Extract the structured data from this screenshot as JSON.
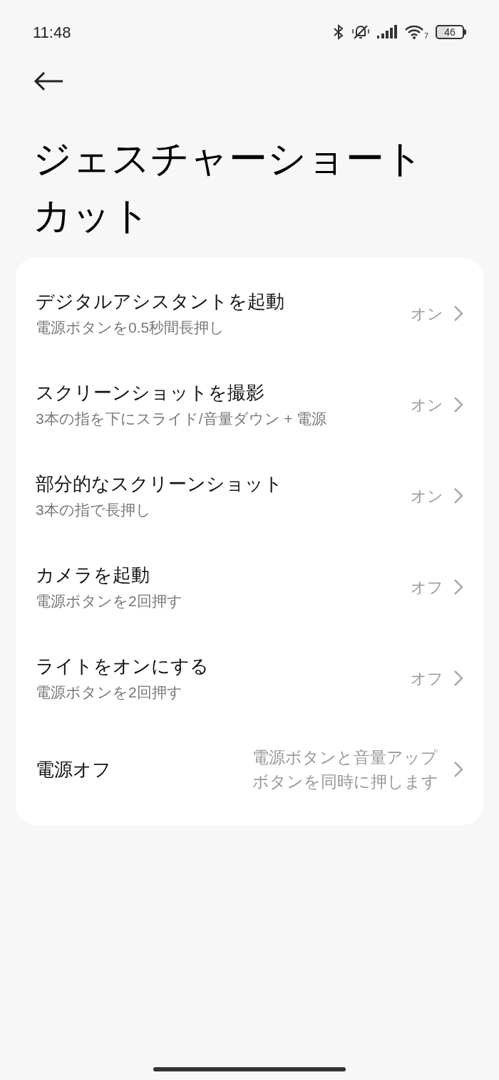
{
  "status_bar": {
    "time": "11:48",
    "wifi_badge": "7",
    "battery": "46"
  },
  "title": "ジェスチャーショートカット",
  "items": [
    {
      "title": "デジタルアシスタントを起動",
      "subtitle": "電源ボタンを0.5秒間長押し",
      "value": "オン"
    },
    {
      "title": "スクリーンショットを撮影",
      "subtitle": "3本の指を下にスライド/音量ダウン + 電源",
      "value": "オン"
    },
    {
      "title": "部分的なスクリーンショット",
      "subtitle": "3本の指で長押し",
      "value": "オン"
    },
    {
      "title": "カメラを起動",
      "subtitle": "電源ボタンを2回押す",
      "value": "オフ"
    },
    {
      "title": "ライトをオンにする",
      "subtitle": "電源ボタンを2回押す",
      "value": "オフ"
    },
    {
      "title": "電源オフ",
      "value": "電源ボタンと音量アップボタンを同時に押します"
    }
  ]
}
